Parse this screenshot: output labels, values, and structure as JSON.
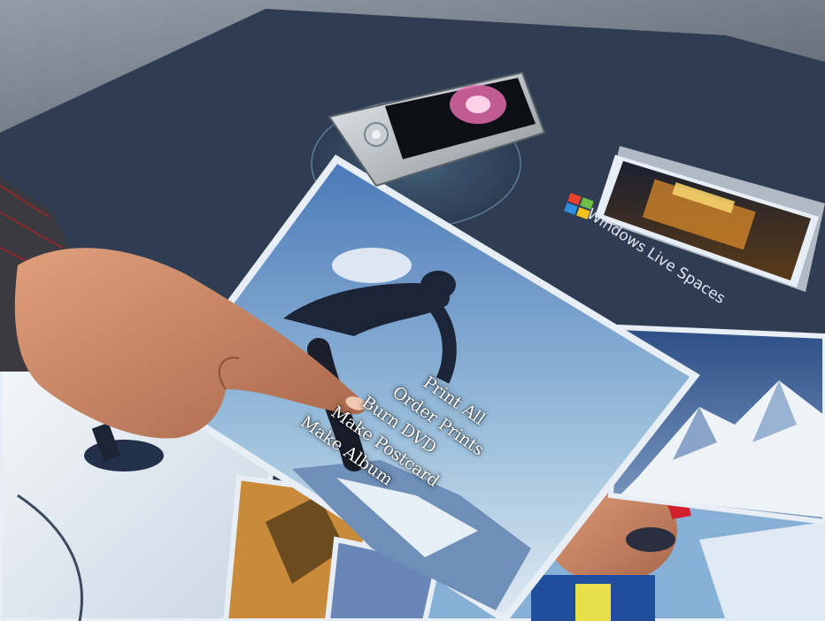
{
  "photo_menu": {
    "items": [
      {
        "label": "Print All"
      },
      {
        "label": "Order Prints"
      },
      {
        "label": "Burn DVD"
      },
      {
        "label": "Make Postcard"
      },
      {
        "label": "Make Album"
      }
    ]
  },
  "spaces_card": {
    "label": "Windows Live Spaces",
    "logo": "windows-flag-icon"
  },
  "colors": {
    "table_surface": "#2e3b52",
    "photo_border": "#e8eef6",
    "menu_text": "#ffffff",
    "device_glow": "#8fd3ff"
  }
}
